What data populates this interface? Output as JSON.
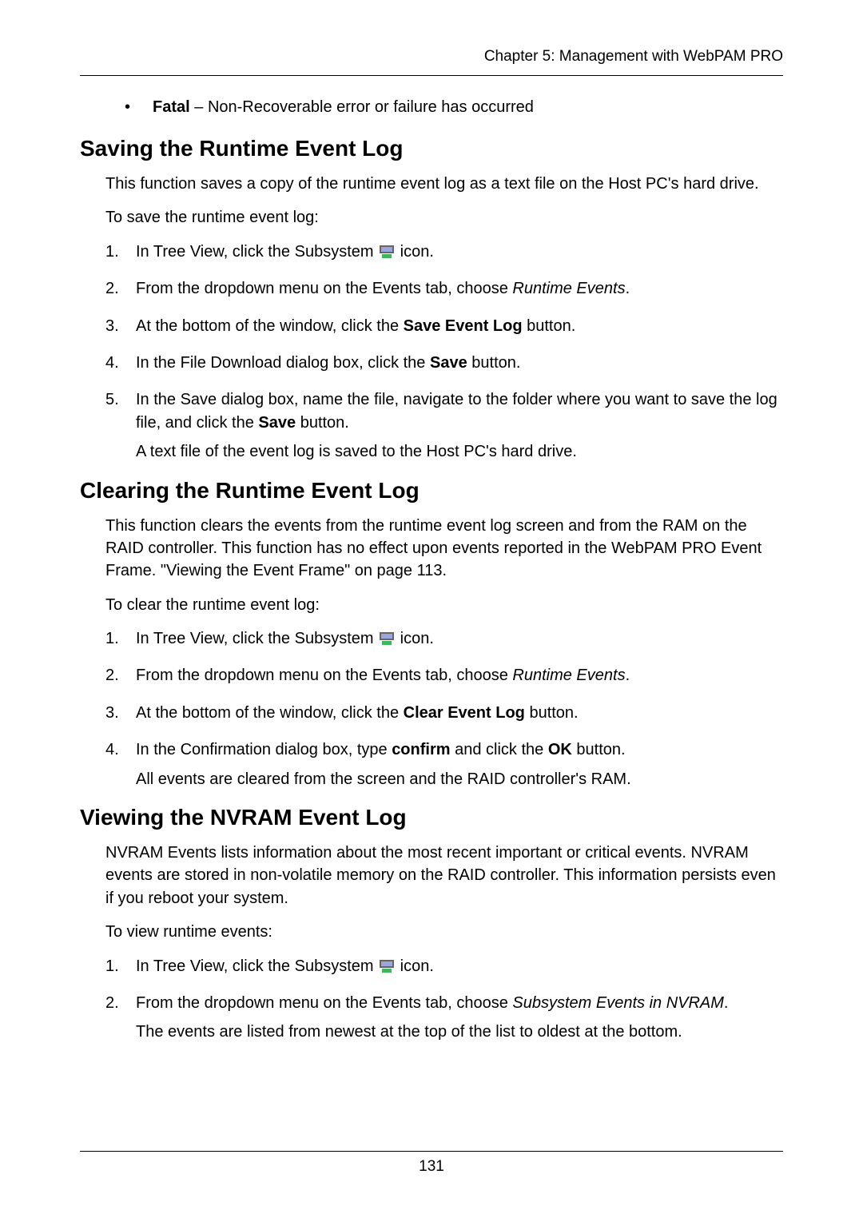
{
  "header": "Chapter 5: Management with WebPAM PRO",
  "bullet": {
    "term": "Fatal",
    "desc": " – Non-Recoverable error or failure has occurred"
  },
  "section1": {
    "heading": "Saving the Runtime Event Log",
    "p1": "This function saves a copy of the runtime event log as a text file on the Host PC's hard drive.",
    "p2": "To save the runtime event log:",
    "steps": {
      "s1a": "In Tree View, click the Subsystem ",
      "s1b": " icon.",
      "s2a": "From the dropdown menu on the Events tab, choose ",
      "s2b": "Runtime Events",
      "s2c": ".",
      "s3a": "At the bottom of the window, click the ",
      "s3b": "Save Event Log",
      "s3c": " button.",
      "s4a": "In the File Download dialog box, click the ",
      "s4b": "Save",
      "s4c": " button.",
      "s5a": "In the Save dialog box, name the file, navigate to the folder where you want to save the log file, and click the ",
      "s5b": "Save",
      "s5c": " button.",
      "s5d": "A text file of the event log is saved to the Host PC's hard drive."
    }
  },
  "section2": {
    "heading": "Clearing the Runtime Event Log",
    "p1": "This function clears the events from the runtime event log screen and from the RAM on the RAID controller. This function has no effect upon events reported in the WebPAM PRO Event Frame. \"Viewing the Event Frame\" on page 113.",
    "p2": "To clear the runtime event log:",
    "steps": {
      "s1a": "In Tree View, click the Subsystem ",
      "s1b": " icon.",
      "s2a": "From the dropdown menu on the Events tab, choose ",
      "s2b": "Runtime Events",
      "s2c": ".",
      "s3a": "At the bottom of the window, click the ",
      "s3b": "Clear Event Log",
      "s3c": " button.",
      "s4a": "In the Confirmation dialog box, type ",
      "s4b": "confirm",
      "s4c": " and click the ",
      "s4d": "OK",
      "s4e": " button.",
      "s4f": "All events are cleared from the screen and the RAID controller's RAM."
    }
  },
  "section3": {
    "heading": "Viewing the NVRAM Event Log",
    "p1": "NVRAM Events lists information about the most recent important or critical events. NVRAM events are stored in non-volatile memory on the RAID controller. This information persists even if you reboot your system.",
    "p2": "To view runtime events:",
    "steps": {
      "s1a": "In Tree View, click the Subsystem ",
      "s1b": " icon.",
      "s2a": "From the dropdown menu on the Events tab, choose ",
      "s2b": "Subsystem Events in NVRAM",
      "s2c": ".",
      "s2d": "The events are listed from newest at the top of the list to oldest at the bottom."
    }
  },
  "page_number": "131"
}
